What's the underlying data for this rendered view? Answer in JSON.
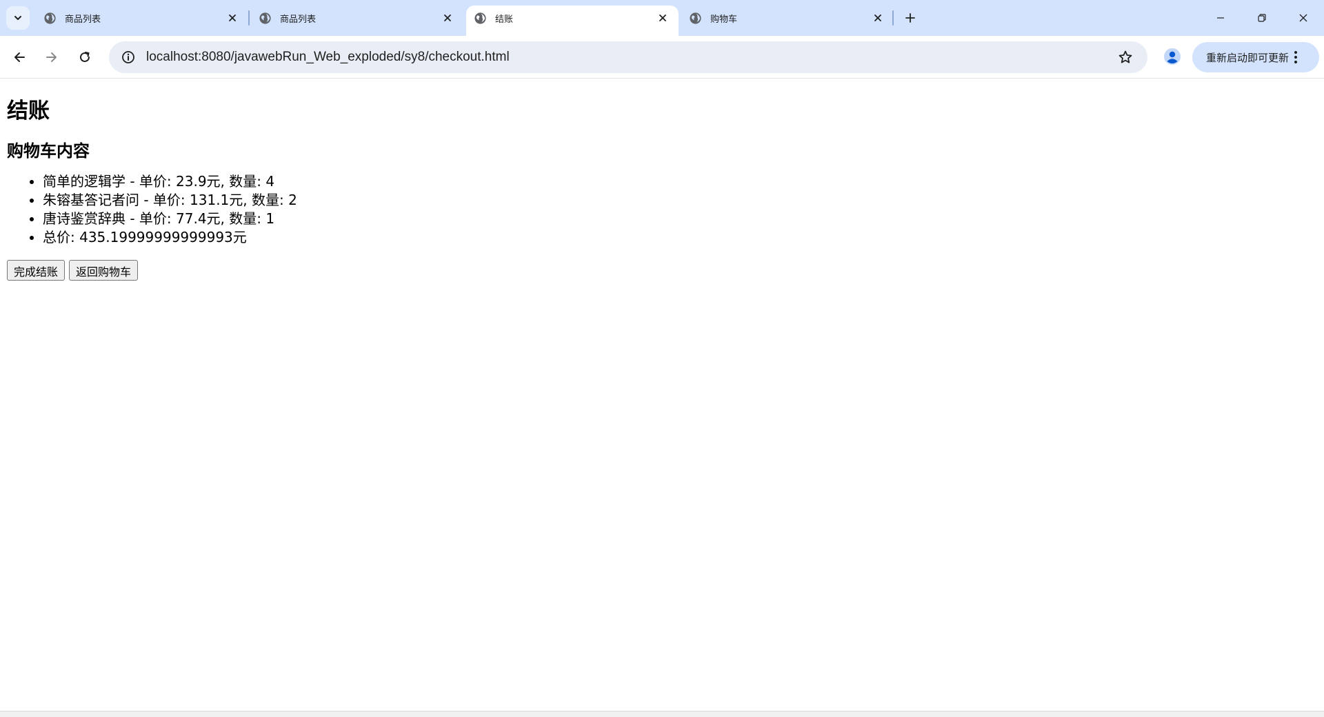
{
  "browser": {
    "tabs": [
      {
        "title": "商品列表",
        "active": false
      },
      {
        "title": "商品列表",
        "active": false
      },
      {
        "title": "结账",
        "active": true
      },
      {
        "title": "购物车",
        "active": false
      }
    ],
    "url": "localhost:8080/javawebRun_Web_exploded/sy8/checkout.html",
    "update_label": "重新启动即可更新",
    "accent_color": "#d3e3fd"
  },
  "page": {
    "title": "结账",
    "cart_heading": "购物车内容",
    "items": [
      "简单的逻辑学 - 单价: 23.9元, 数量: 4",
      "朱镕基答记者问 - 单价: 131.1元, 数量: 2",
      "唐诗鉴赏辞典 - 单价: 77.4元, 数量: 1",
      "总价: 435.19999999999993元"
    ],
    "complete_button": "完成结账",
    "back_button": "返回购物车"
  }
}
